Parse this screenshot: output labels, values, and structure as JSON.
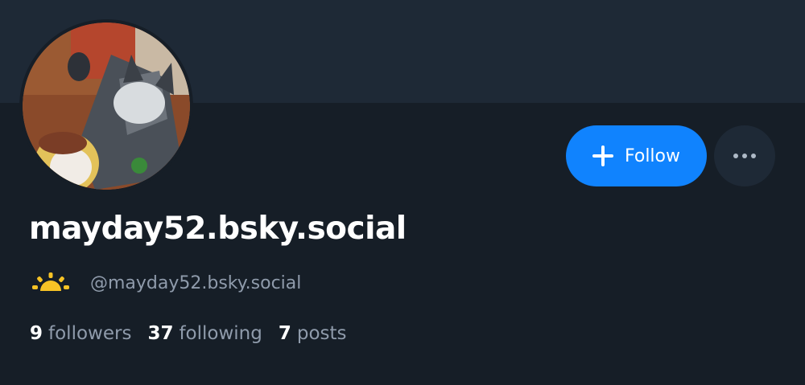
{
  "profile": {
    "display_name": "mayday52.bsky.social",
    "handle": "@mayday52.bsky.social",
    "status_icon": "sun-icon",
    "avatar_description_icon": "avatar-photo"
  },
  "actions": {
    "follow_label": "Follow",
    "follow_icon": "plus-icon",
    "more_icon": "ellipsis-icon"
  },
  "stats": {
    "followers_count": "9",
    "followers_label": "followers",
    "following_count": "37",
    "following_label": "following",
    "posts_count": "7",
    "posts_label": "posts"
  },
  "colors": {
    "background": "#161e27",
    "banner": "#1e2936",
    "accent": "#1083fe",
    "muted_text": "#8f9bab",
    "sun": "#f7c325"
  }
}
